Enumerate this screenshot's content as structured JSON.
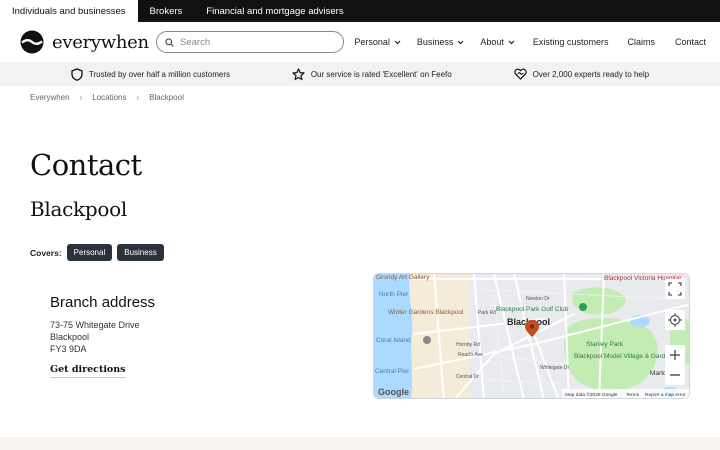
{
  "topbar": {
    "tabs": [
      "Individuals and businesses",
      "Brokers",
      "Financial and mortgage advisers"
    ]
  },
  "header": {
    "logo_text": "everywhen",
    "search_placeholder": "Search",
    "nav": [
      {
        "label": "Personal",
        "has_dropdown": true
      },
      {
        "label": "Business",
        "has_dropdown": true
      },
      {
        "label": "About",
        "has_dropdown": true
      },
      {
        "label": "Existing customers",
        "has_dropdown": false
      },
      {
        "label": "Claims",
        "has_dropdown": false
      },
      {
        "label": "Contact",
        "has_dropdown": false
      }
    ]
  },
  "trust": [
    {
      "icon": "shield-icon",
      "text": "Trusted by over half a million customers"
    },
    {
      "icon": "star-icon",
      "text": "Our service is rated 'Excellent' on Feefo"
    },
    {
      "icon": "heart-icon",
      "text": "Over 2,000 experts ready to help"
    }
  ],
  "breadcrumb": [
    "Everywhen",
    "Locations",
    "Blackpool"
  ],
  "breadcrumb_separator": "›",
  "page": {
    "title": "Contact",
    "subtitle": "Blackpool",
    "covers_label": "Covers:",
    "covers": [
      "Personal",
      "Business"
    ]
  },
  "branch": {
    "heading": "Branch address",
    "address": [
      "73-75 Whitegate Drive",
      "Blackpool",
      "FY3 9DA"
    ],
    "directions_label": "Get directions"
  },
  "map": {
    "labels": {
      "grundy": "Grundy Art Gallery",
      "north_pier": "North Pier",
      "winter_gardens": "Winter Gardens Blackpool",
      "coral_island": "Coral Island",
      "central_pier": "Central Pier",
      "golf_club": "Blackpool Park Golf Club",
      "city": "Blackpool",
      "victoria_hospital": "Blackpool Victoria Hospital",
      "stanley_park": "Stanley Park",
      "model_village": "Blackpool Model Village & Gardens",
      "marton": "Marto",
      "newton_dr": "Newton Dr",
      "park_rd": "Park Rd",
      "hornby_rd": "Hornby Rd",
      "reads_ave": "Read's Ave",
      "central_dr": "Central Dr",
      "whitegate_dr": "Whitegate Dr",
      "google": "Google",
      "attribution": "Map data ©2026 Google",
      "terms": "Terms",
      "report": "Report a map error"
    },
    "colors": {
      "sea": "#aadaff",
      "park": "#c3ecb2",
      "land": "#e8eaed",
      "town": "#f4ecd8",
      "pin": "#c74e1c"
    }
  }
}
